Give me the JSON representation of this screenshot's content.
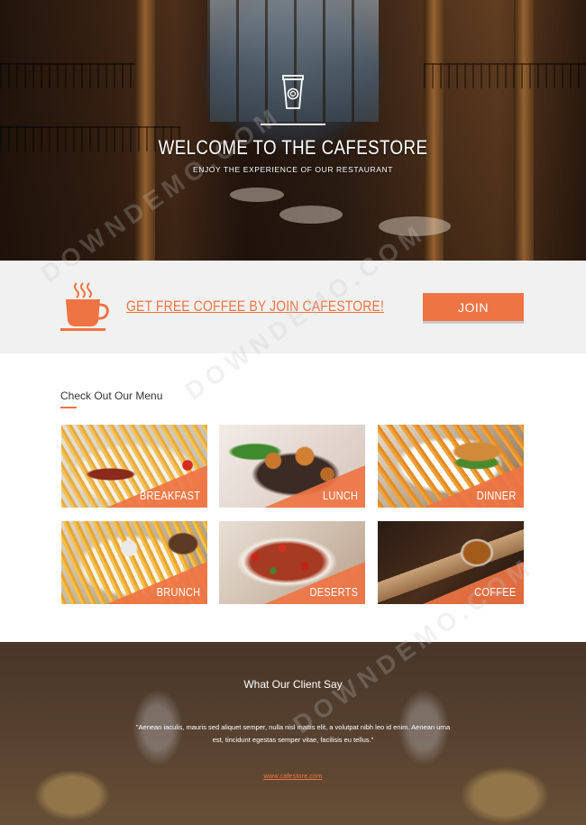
{
  "hero": {
    "title": "WELCOME TO THE CAFESTORE",
    "subtitle": "ENJOY THE EXPERIENCE OF OUR RESTAURANT"
  },
  "promo": {
    "text": "GET FREE COFFEE BY JOIN CAFESTORE!",
    "join_label": "JOIN"
  },
  "menu": {
    "title": "Check Out Our Menu",
    "items": [
      {
        "label": "BREAKFAST"
      },
      {
        "label": "LUNCH"
      },
      {
        "label": "DINNER"
      },
      {
        "label": "BRUNCH"
      },
      {
        "label": "DESERTS"
      },
      {
        "label": "COFFEE"
      }
    ]
  },
  "testimonial": {
    "title": "What Our Client Say",
    "quote": "\"Aenean iaculis, mauris sed aliquet semper, nulla nisl mattis elit, a volutpat nibh leo id enim. Aenean urna est, tincidunt egestas semper vitae, facilisis eu tellus.\"",
    "author": "www.cafestore.com"
  },
  "watermark": "DOWNDEMO.COM",
  "colors": {
    "accent": "#ef7444",
    "promo_bg": "#f1f1f1"
  },
  "icons": [
    "cup-icon",
    "coffee-cup-icon"
  ]
}
